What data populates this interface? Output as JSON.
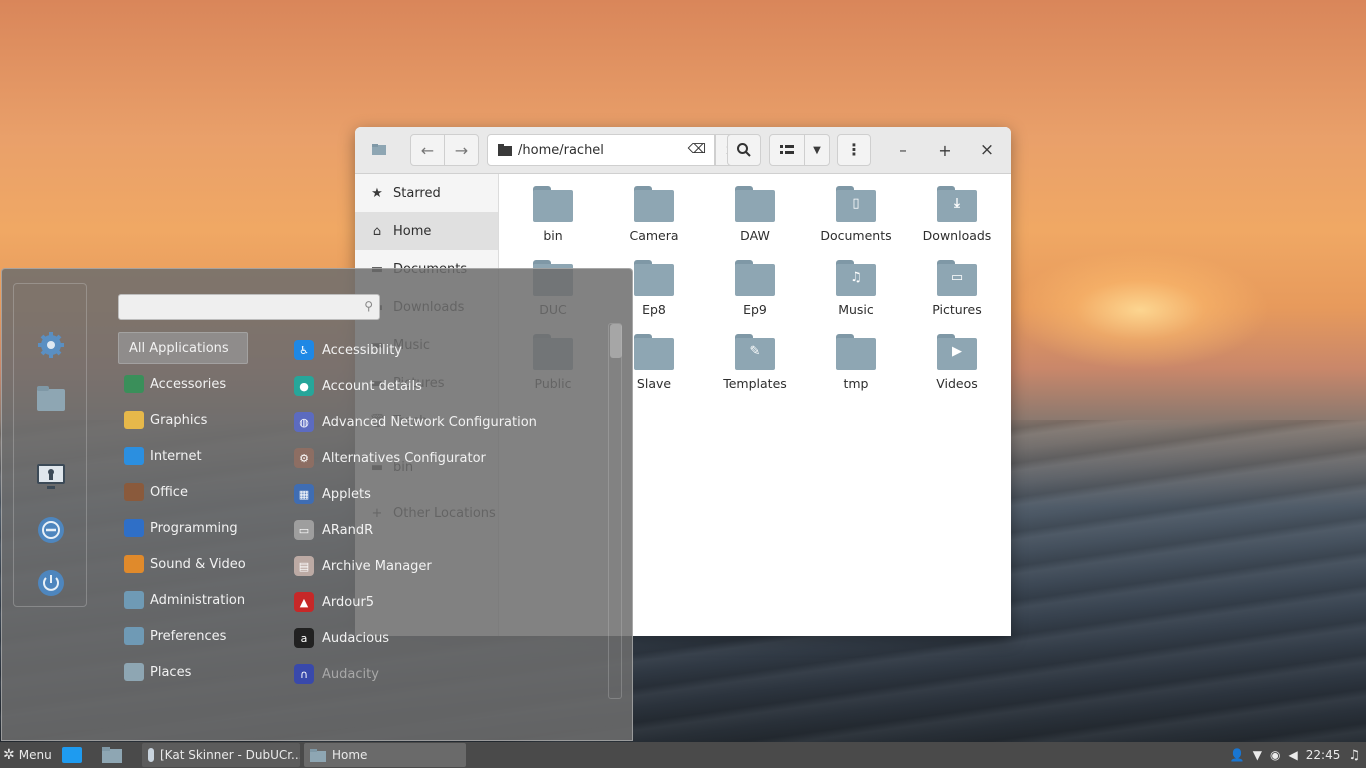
{
  "file_manager": {
    "path": "/home/rachel",
    "sidebar": [
      {
        "label": "Starred",
        "icon": "star-icon"
      },
      {
        "label": "Home",
        "icon": "home-icon"
      },
      {
        "label": "Documents",
        "icon": "folder-icon"
      },
      {
        "label": "Downloads",
        "icon": "folder-icon"
      },
      {
        "label": "Music",
        "icon": "folder-icon"
      },
      {
        "label": "Pictures",
        "icon": "folder-icon"
      },
      {
        "label": "Trash",
        "icon": "trash-icon"
      },
      {
        "label": "bin",
        "icon": "folder-icon"
      },
      {
        "label": "Other Locations",
        "icon": "plus-icon"
      }
    ],
    "folders": [
      {
        "label": "bin",
        "glyph": ""
      },
      {
        "label": "Camera",
        "glyph": ""
      },
      {
        "label": "DAW",
        "glyph": ""
      },
      {
        "label": "Documents",
        "glyph": "▯"
      },
      {
        "label": "Downloads",
        "glyph": "⤓"
      },
      {
        "label": "DUC",
        "glyph": ""
      },
      {
        "label": "Ep8",
        "glyph": ""
      },
      {
        "label": "Ep9",
        "glyph": ""
      },
      {
        "label": "Music",
        "glyph": "♫"
      },
      {
        "label": "Pictures",
        "glyph": "▭"
      },
      {
        "label": "Public",
        "glyph": ""
      },
      {
        "label": "Slave",
        "glyph": ""
      },
      {
        "label": "Templates",
        "glyph": "✎"
      },
      {
        "label": "tmp",
        "glyph": ""
      },
      {
        "label": "Videos",
        "glyph": "▶"
      }
    ]
  },
  "menu": {
    "search_placeholder": "",
    "categories": [
      {
        "label": "All Applications",
        "color": ""
      },
      {
        "label": "Accessories",
        "color": "#3a8f5a"
      },
      {
        "label": "Graphics",
        "color": "#e6b84a"
      },
      {
        "label": "Internet",
        "color": "#2b8fe0"
      },
      {
        "label": "Office",
        "color": "#8a5a3c"
      },
      {
        "label": "Programming",
        "color": "#2f6fc7"
      },
      {
        "label": "Sound & Video",
        "color": "#e08a2b"
      },
      {
        "label": "Administration",
        "color": "#6f9ab5"
      },
      {
        "label": "Preferences",
        "color": "#6f9ab5"
      },
      {
        "label": "Places",
        "color": "#8ea6b3"
      }
    ],
    "apps": [
      {
        "label": "Accessibility",
        "color": "#1e88e5",
        "glyph": "♿"
      },
      {
        "label": "Account details",
        "color": "#26a69a",
        "glyph": "●"
      },
      {
        "label": "Advanced Network Configuration",
        "color": "#5c6bc0",
        "glyph": "◍"
      },
      {
        "label": "Alternatives Configurator",
        "color": "#8d6e63",
        "glyph": "⚙"
      },
      {
        "label": "Applets",
        "color": "#3f6db3",
        "glyph": "▦"
      },
      {
        "label": "ARandR",
        "color": "#9e9e9e",
        "glyph": "▭"
      },
      {
        "label": "Archive Manager",
        "color": "#bcaaa4",
        "glyph": "▤"
      },
      {
        "label": "Ardour5",
        "color": "#c62828",
        "glyph": "▲"
      },
      {
        "label": "Audacious",
        "color": "#212121",
        "glyph": "a"
      },
      {
        "label": "Audacity",
        "color": "#3949ab",
        "glyph": "∩"
      }
    ]
  },
  "taskbar": {
    "menu_label": "Menu",
    "windows": [
      {
        "label": "[Kat Skinner - DubUCr..."
      },
      {
        "label": "Home"
      }
    ],
    "clock": "22:45"
  }
}
